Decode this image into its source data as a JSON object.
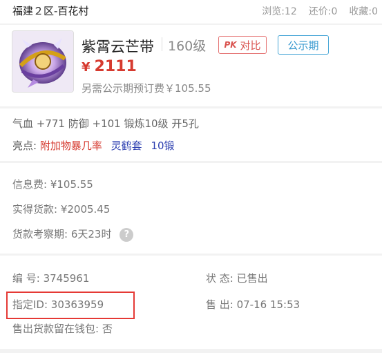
{
  "header": {
    "server": "福建２区-百花村",
    "views": "浏览:12",
    "bargains": "还价:0",
    "favorites": "收藏:0"
  },
  "item": {
    "name": "紫霄云芒带",
    "level": "160级",
    "compare_label": "对比",
    "compare_icon_text": "PK",
    "period_badge": "公示期",
    "price_symbol": "¥",
    "price": "2111",
    "extra_fee": "另需公示期预订费￥105.55"
  },
  "attributes": {
    "stats_line": "气血 +771 防御 +101 锻炼10级 开5孔",
    "highlights_label": "亮点:",
    "highlights": [
      "附加物暴几率",
      "灵鹤套",
      "10锻"
    ]
  },
  "fees": {
    "info_fee": "信息费: ¥105.55",
    "actual_payment": "实得货款: ¥2005.45",
    "observation_period": "货款考察期: 6天23时",
    "help_icon": "?"
  },
  "order": {
    "number": "编 号:  3745961",
    "status": "状 态:  已售出",
    "designated_id": "指定ID:  30363959",
    "sold_time": "售 出:  07-16 15:53",
    "keep_in_wallet": "售出货款留在钱包:  否"
  }
}
